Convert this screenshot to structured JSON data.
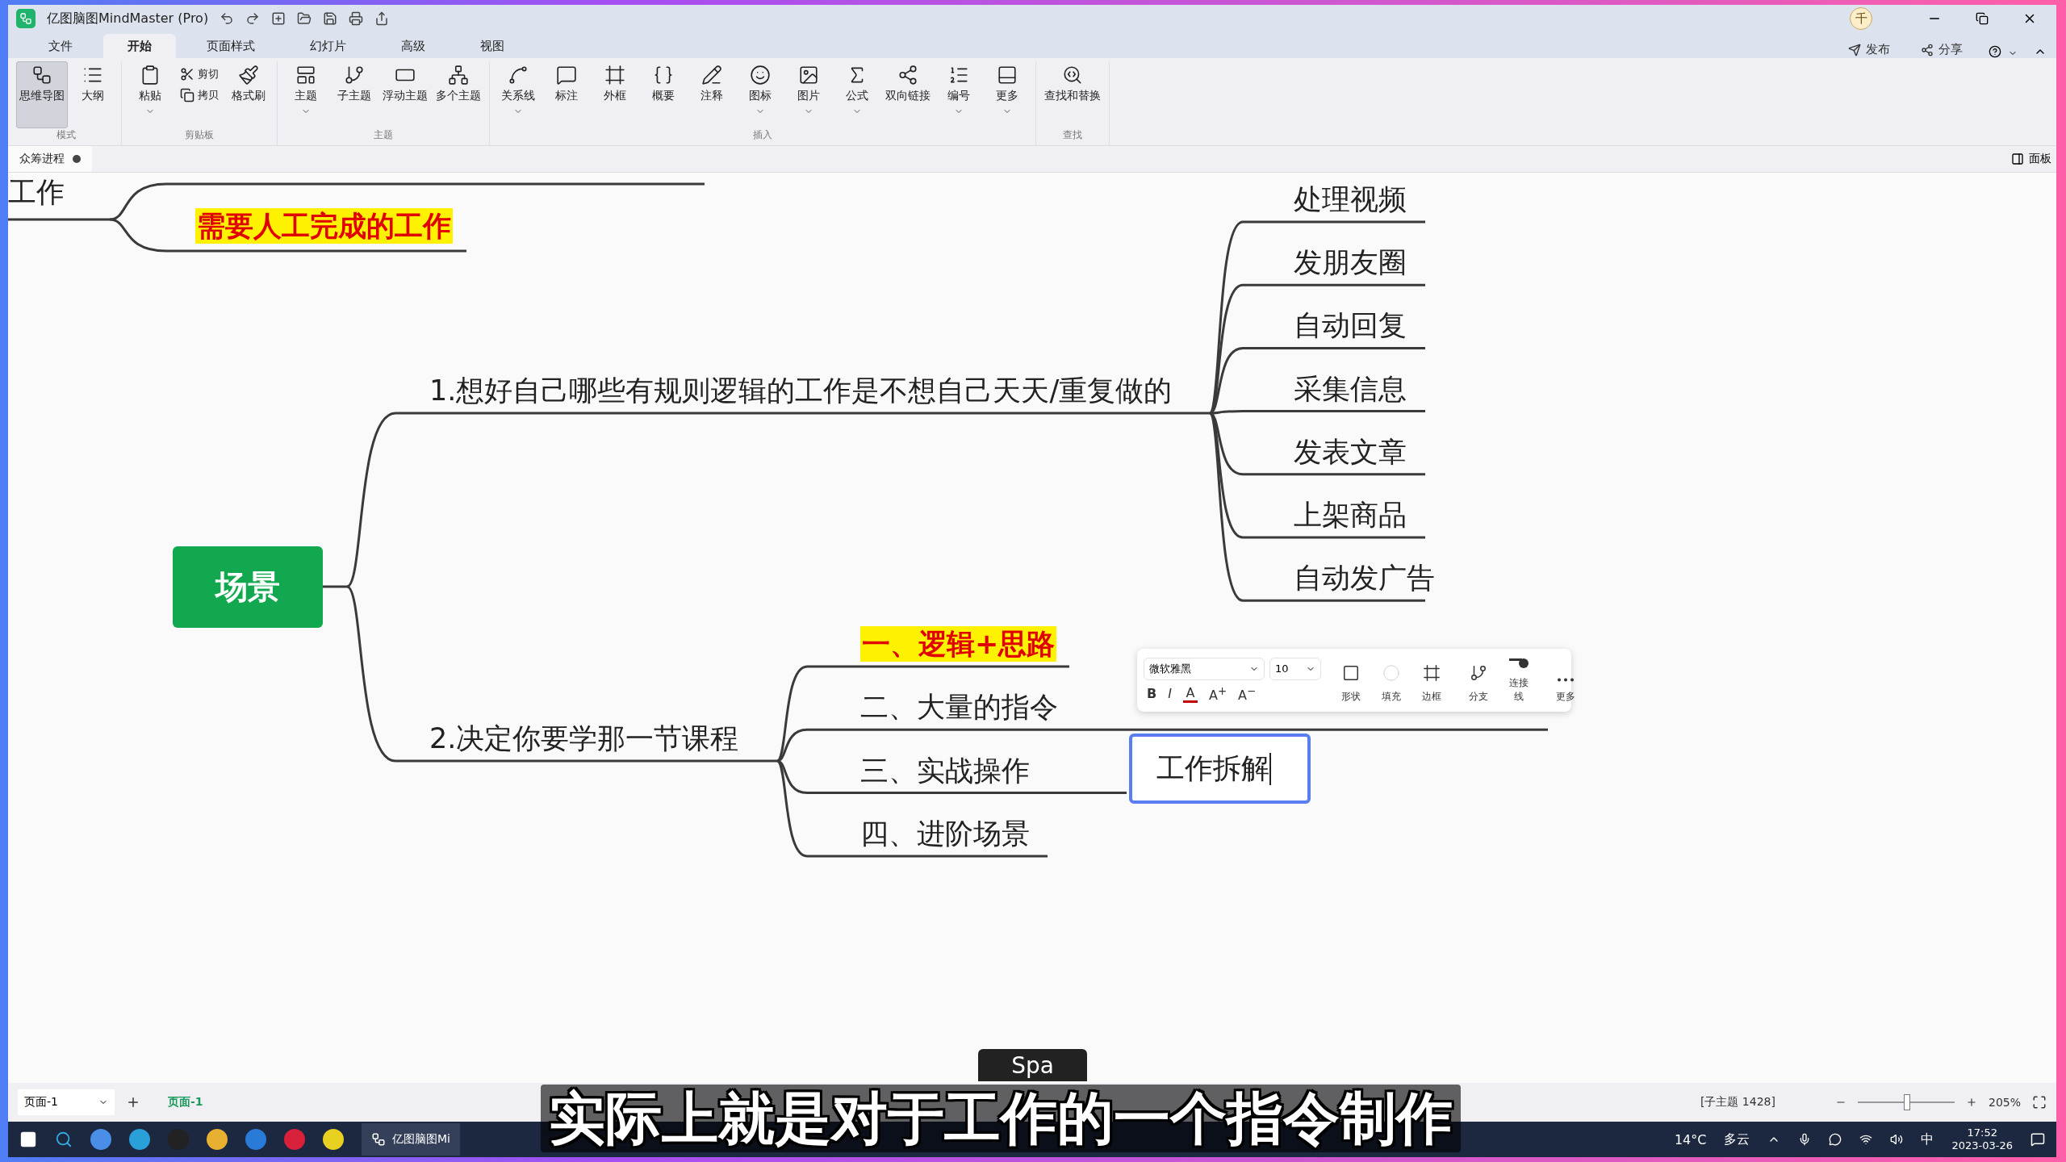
{
  "window": {
    "title": "亿图脑图MindMaster (Pro)",
    "avatar": "千"
  },
  "menu_tabs": [
    {
      "label": "文件",
      "selected": false
    },
    {
      "label": "开始",
      "selected": true
    },
    {
      "label": "页面样式",
      "selected": false
    },
    {
      "label": "幻灯片",
      "selected": false
    },
    {
      "label": "高级",
      "selected": false
    },
    {
      "label": "视图",
      "selected": false
    }
  ],
  "top_actions": [
    "发布",
    "分享"
  ],
  "ribbon": [
    {
      "label": "模式",
      "items": [
        {
          "label": "思维导图",
          "kind": "large",
          "caret": false,
          "selected": true
        },
        {
          "label": "大纲",
          "kind": "large",
          "caret": false,
          "selected": false
        }
      ]
    },
    {
      "label": "剪贴板",
      "items": [
        {
          "label": "粘贴",
          "kind": "large",
          "caret": true
        },
        {
          "label": "剪切",
          "kind": "small",
          "caret": false
        },
        {
          "label": "拷贝",
          "kind": "small",
          "caret": false
        },
        {
          "label": "格式刷",
          "kind": "large",
          "caret": false
        }
      ]
    },
    {
      "label": "主题",
      "items": [
        {
          "label": "主题",
          "kind": "large",
          "caret": true
        },
        {
          "label": "子主题",
          "kind": "large",
          "caret": false
        },
        {
          "label": "浮动主题",
          "kind": "large",
          "caret": false
        },
        {
          "label": "多个主题",
          "kind": "large",
          "caret": false
        }
      ]
    },
    {
      "label": "插入",
      "items": [
        {
          "label": "关系线",
          "kind": "large",
          "caret": true
        },
        {
          "label": "标注",
          "kind": "large",
          "caret": false
        },
        {
          "label": "外框",
          "kind": "large",
          "caret": false
        },
        {
          "label": "概要",
          "kind": "large",
          "caret": false
        },
        {
          "label": "注释",
          "kind": "large",
          "caret": false
        },
        {
          "label": "图标",
          "kind": "large",
          "caret": true
        },
        {
          "label": "图片",
          "kind": "large",
          "caret": true
        },
        {
          "label": "公式",
          "kind": "large",
          "caret": true
        },
        {
          "label": "双向链接",
          "kind": "large",
          "caret": false
        },
        {
          "label": "编号",
          "kind": "large",
          "caret": true
        },
        {
          "label": "更多",
          "kind": "large",
          "caret": true
        }
      ]
    },
    {
      "label": "查找",
      "items": [
        {
          "label": "查找和替换",
          "kind": "large",
          "caret": false
        }
      ]
    }
  ],
  "document_tab": {
    "title": "众筹进程",
    "unsaved": true
  },
  "panel_toggle": "面板",
  "mindmap": {
    "root": "场景",
    "top_fragment": "工作",
    "top_highlight": "需要人工完成的工作",
    "branches": [
      {
        "label": "1.想好自己哪些有规则逻辑的工作是不想自己天天/重复做的",
        "children": [
          {
            "label": "处理视频",
            "highlight": false
          },
          {
            "label": "发朋友圈",
            "highlight": false
          },
          {
            "label": "自动回复",
            "highlight": false
          },
          {
            "label": "采集信息",
            "highlight": false
          },
          {
            "label": "发表文章",
            "highlight": false
          },
          {
            "label": "上架商品",
            "highlight": false
          },
          {
            "label": "自动发广告",
            "highlight": false
          }
        ]
      },
      {
        "label": "2.决定你要学那一节课程",
        "children": [
          {
            "label": "一、逻辑+思路",
            "highlight": true
          },
          {
            "label": "二、大量的指令",
            "highlight": false
          },
          {
            "label": "三、实战操作",
            "highlight": false
          },
          {
            "label": "四、进阶场景",
            "highlight": false
          }
        ]
      }
    ],
    "editing": {
      "value": "工作拆解"
    }
  },
  "format_toolbar": {
    "font": "微软雅黑",
    "size": "10",
    "text_buttons": [
      "B",
      "I",
      "A",
      "A$^{+}$",
      "A$^{−}$"
    ],
    "buttons": [
      "形状",
      "填充",
      "边框",
      "分支",
      "连接线",
      "更多"
    ]
  },
  "status_bar": {
    "page_select": "页面-1",
    "page_tab": "页面-1",
    "selection": "[子主题 1428]",
    "zoom": "205%",
    "level": 0.5
  },
  "taskbar": {
    "running_app": "亿图脑图Mi",
    "temperature": "14°C",
    "weather": "多云",
    "ime": "中",
    "time": "17:52",
    "date": "2023-03-26"
  },
  "key_hint": "Spa",
  "subtitle": "实际上就是对于工作的一个指令制作"
}
